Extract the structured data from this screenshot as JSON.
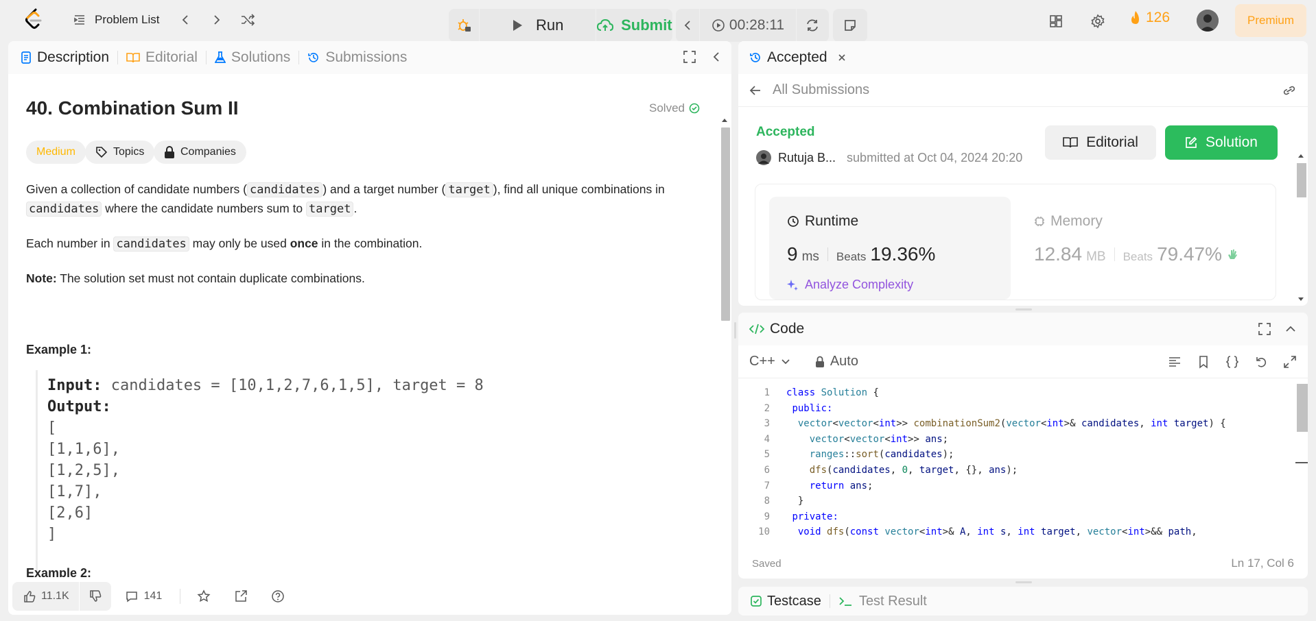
{
  "header": {
    "problem_list": "Problem List",
    "run": "Run",
    "submit": "Submit",
    "timer": "00:28:11",
    "streak": "126",
    "premium": "Premium"
  },
  "left": {
    "tabs": [
      "Description",
      "Editorial",
      "Solutions",
      "Submissions"
    ],
    "title": "40. Combination Sum II",
    "solved": "Solved",
    "chips": [
      "Medium",
      "Topics",
      "Companies"
    ],
    "para1": {
      "t1": "Given a collection of candidate numbers (",
      "c1": "candidates",
      "t2": ") and a target number (",
      "c2": "target",
      "t3": "), find all unique combinations in",
      "c3": "candidates",
      "t4": " where the candidate numbers sum to ",
      "c4": "target",
      "t5": "."
    },
    "para2": {
      "t1": "Each number in ",
      "c1": "candidates",
      "t2": " may only be used ",
      "b1": "once",
      "t3": " in the combination."
    },
    "note": {
      "label": "Note:",
      "text": " The solution set must not contain duplicate combinations."
    },
    "example1": {
      "title": "Example 1:",
      "input_label": "Input:",
      "input": " candidates = [10,1,2,7,6,1,5], target = 8",
      "output_label": "Output:",
      "rows": [
        "[",
        "[1,1,6],",
        "[1,2,5],",
        "[1,7],",
        "[2,6]",
        "]"
      ]
    },
    "example2_title": "Example 2:",
    "likes": "11.1K",
    "comments": "141"
  },
  "result": {
    "tab": "Accepted",
    "all_submissions": "All Submissions",
    "status": "Accepted",
    "user": "Rutuja B...",
    "submitted_at": "submitted at Oct 04, 2024 20:20",
    "editorial_btn": "Editorial",
    "solution_btn": "Solution",
    "runtime": {
      "label": "Runtime",
      "value": "9",
      "unit": "ms",
      "beats_label": "Beats",
      "beats": "19.36%",
      "analyze": "Analyze Complexity"
    },
    "memory": {
      "label": "Memory",
      "value": "12.84",
      "unit": "MB",
      "beats_label": "Beats",
      "beats": "79.47%"
    }
  },
  "code": {
    "title": "Code",
    "language": "C++",
    "mode": "Auto",
    "status": "Saved",
    "cursor": "Ln 17, Col 6",
    "line_numbers": [
      "1",
      "2",
      "3",
      "4",
      "5",
      "6",
      "7",
      "8",
      "9",
      "10"
    ],
    "lines": [
      [
        "class ",
        "Solution",
        " {"
      ],
      [
        " public:"
      ],
      [
        "  vector<vector<int>> combinationSum2(vector<int>& candidates, int target) {"
      ],
      [
        "    vector<vector<int>> ans;"
      ],
      [
        "    ranges::sort(candidates);"
      ],
      [
        "    dfs(candidates, 0, target, {}, ans);"
      ],
      [
        "    return ans;"
      ],
      [
        "  }"
      ],
      [
        " private:"
      ],
      [
        "  void dfs(const vector<int>& A, int s, int target, vector<int>&& path,"
      ]
    ]
  },
  "test": {
    "testcase": "Testcase",
    "test_result": "Test Result"
  }
}
